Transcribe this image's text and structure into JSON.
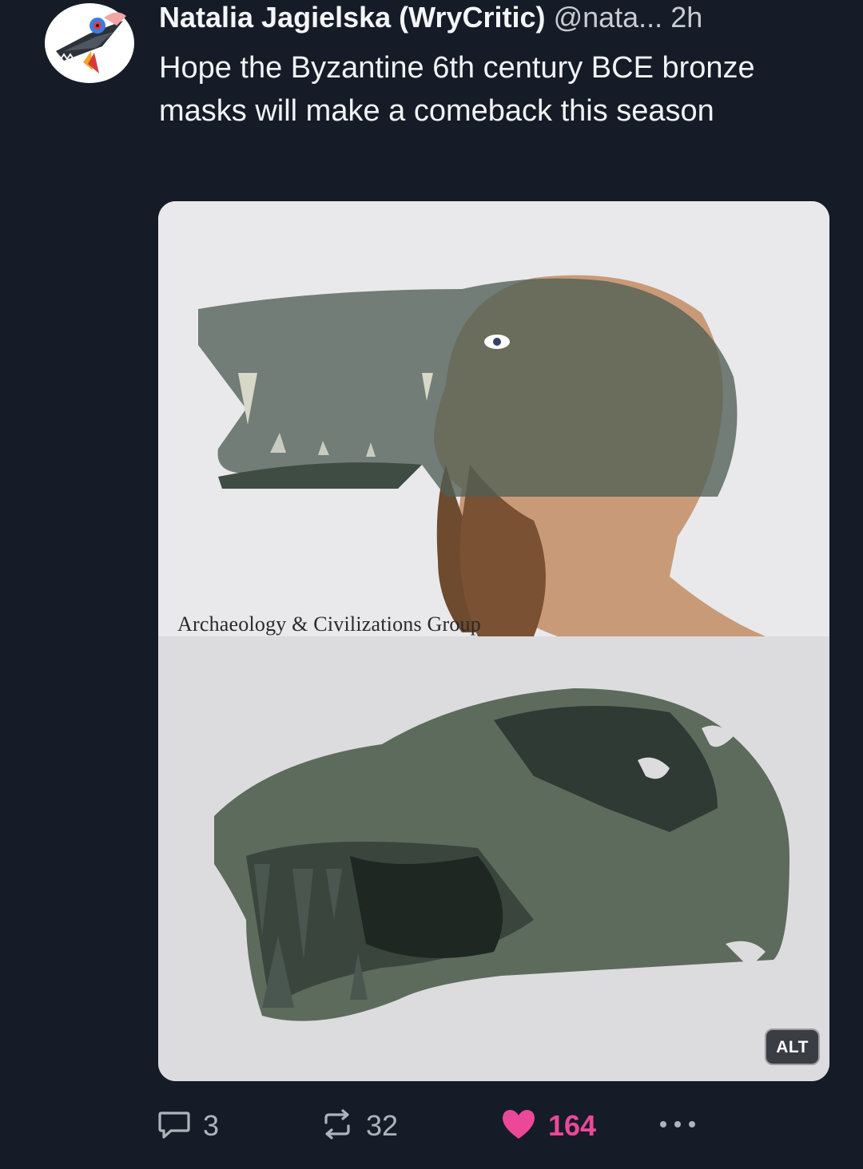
{
  "post": {
    "author_name": "Natalia Jagielska (WryCritic)",
    "handle": "@nata...",
    "time": "2h",
    "text": "Hope the Byzantine 6th century BCE bronze masks will make a comeback this season",
    "avatar_icon": "bird-avatar-icon"
  },
  "media": {
    "watermark_text": "Archaeology & Civilizations Group",
    "alt_badge": "ALT"
  },
  "actions": {
    "reply_count": "3",
    "repost_count": "32",
    "like_count": "164",
    "liked": true,
    "like_color": "#ec4899",
    "icons": [
      "reply-icon",
      "repost-icon",
      "heart-icon",
      "more-icon"
    ]
  },
  "colors": {
    "background": "#151c27",
    "text": "#f1f3f5",
    "muted": "#aeb4bc"
  }
}
